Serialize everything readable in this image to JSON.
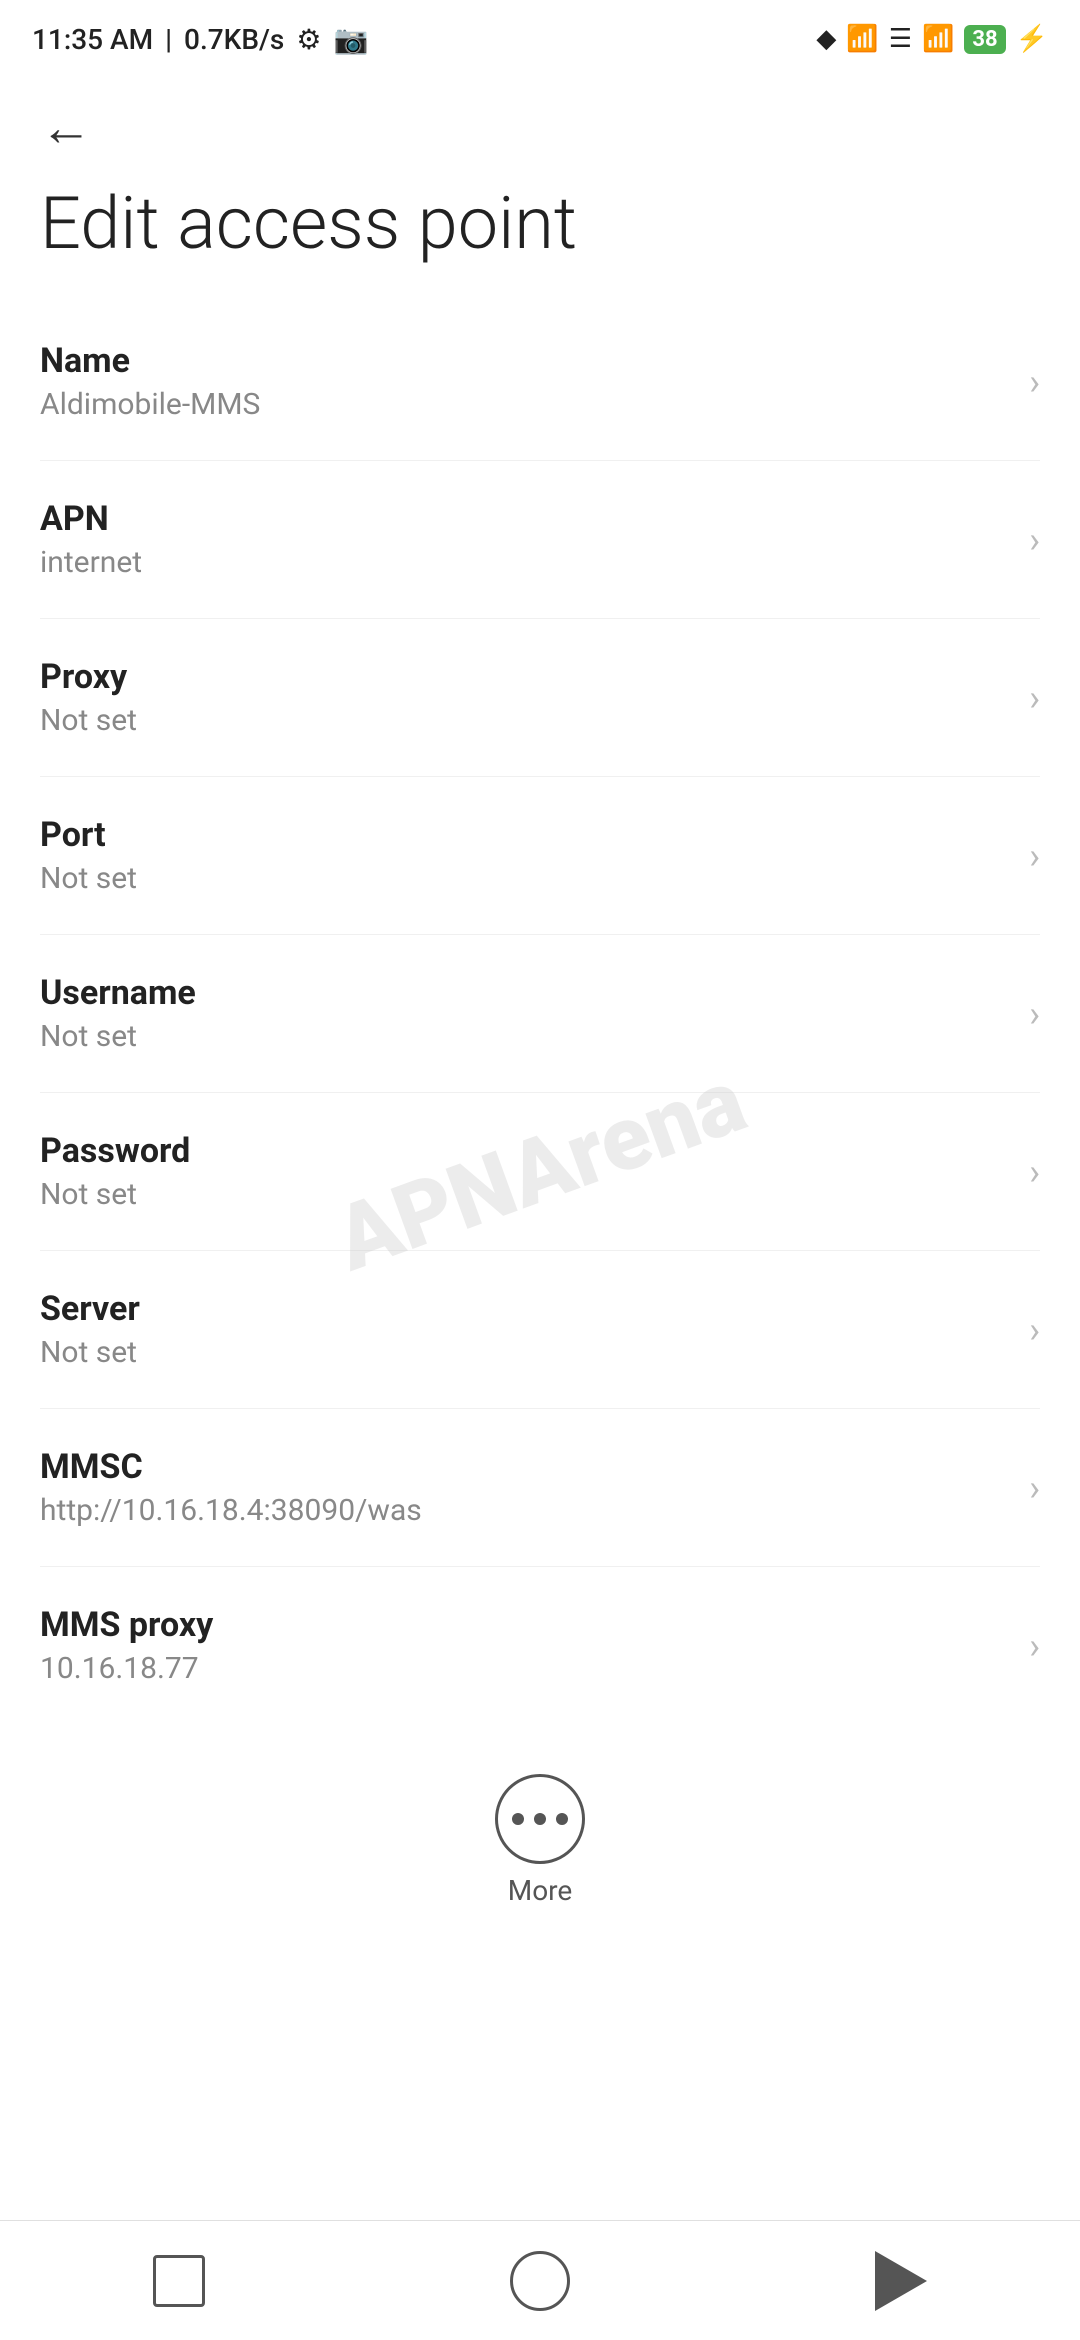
{
  "statusBar": {
    "time": "11:35 AM",
    "speed": "0.7KB/s",
    "battery": "38"
  },
  "header": {
    "backLabel": "←",
    "title": "Edit access point"
  },
  "settings": {
    "items": [
      {
        "label": "Name",
        "value": "Aldimobile-MMS"
      },
      {
        "label": "APN",
        "value": "internet"
      },
      {
        "label": "Proxy",
        "value": "Not set"
      },
      {
        "label": "Port",
        "value": "Not set"
      },
      {
        "label": "Username",
        "value": "Not set"
      },
      {
        "label": "Password",
        "value": "Not set"
      },
      {
        "label": "Server",
        "value": "Not set"
      },
      {
        "label": "MMSC",
        "value": "http://10.16.18.4:38090/was"
      },
      {
        "label": "MMS proxy",
        "value": "10.16.18.77"
      }
    ]
  },
  "more": {
    "label": "More"
  },
  "watermark": "APNArena",
  "navBar": {
    "squareLabel": "recent",
    "circleLabel": "home",
    "triangleLabel": "back"
  }
}
